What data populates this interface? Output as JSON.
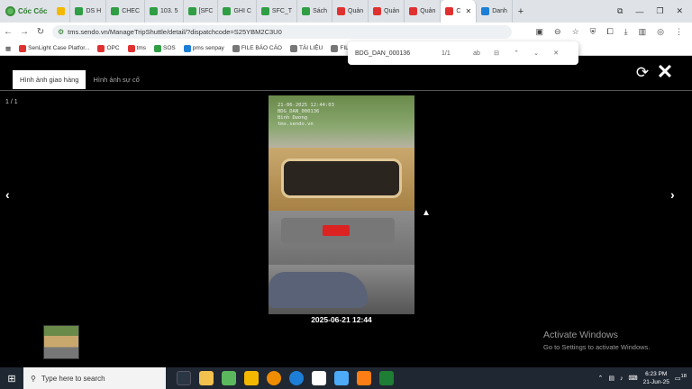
{
  "browser": {
    "brand": "Cốc Cốc",
    "tabs": [
      {
        "label": "DS H",
        "color": "#2f9e44"
      },
      {
        "label": "CHEC",
        "color": "#2f9e44"
      },
      {
        "label": "103. 5",
        "color": "#2f9e44"
      },
      {
        "label": "[SFC",
        "color": "#2f9e44"
      },
      {
        "label": "GHI C",
        "color": "#2f9e44"
      },
      {
        "label": "SFC_T",
        "color": "#2f9e44"
      },
      {
        "label": "Sách",
        "color": "#2f9e44"
      },
      {
        "label": "Quản",
        "color": "#e03131"
      },
      {
        "label": "Quản",
        "color": "#e03131"
      },
      {
        "label": "Quản",
        "color": "#e03131"
      },
      {
        "label": "C",
        "color": "#e03131"
      },
      {
        "label": "Danh",
        "color": "#1c7ed6"
      }
    ],
    "url": "tms.sendo.vn/ManageTripShuttle/detail/?dispatchcode=S25YBM2C3U0",
    "bookmarks": [
      "SenLight Case Platfor...",
      "OPC",
      "tms",
      "SOS",
      "pms senpay",
      "FILE BÁO CÁO",
      "TÀI LIỆU",
      "FIL"
    ]
  },
  "find": {
    "query": "BDG_DAN_000136",
    "count": "1/1",
    "ab_label": "ab"
  },
  "viewer": {
    "tab_delivery": "Hình ảnh giao hàng",
    "tab_incident": "Hình ảnh sự cố",
    "counter": "1 / 1",
    "caption": "2025-06-21 12:44",
    "stamp_lines": [
      "21-06-2025 12:44:03",
      "BDG_DAN_000136",
      "Bình Dương",
      "tms.sendo.vn"
    ]
  },
  "watermark": {
    "title": "Activate Windows",
    "subtitle": "Go to Settings to activate Windows."
  },
  "taskbar": {
    "search_placeholder": "Type here to search",
    "time": "6:23 PM",
    "date": "21-Jun-25",
    "badge": "18"
  }
}
